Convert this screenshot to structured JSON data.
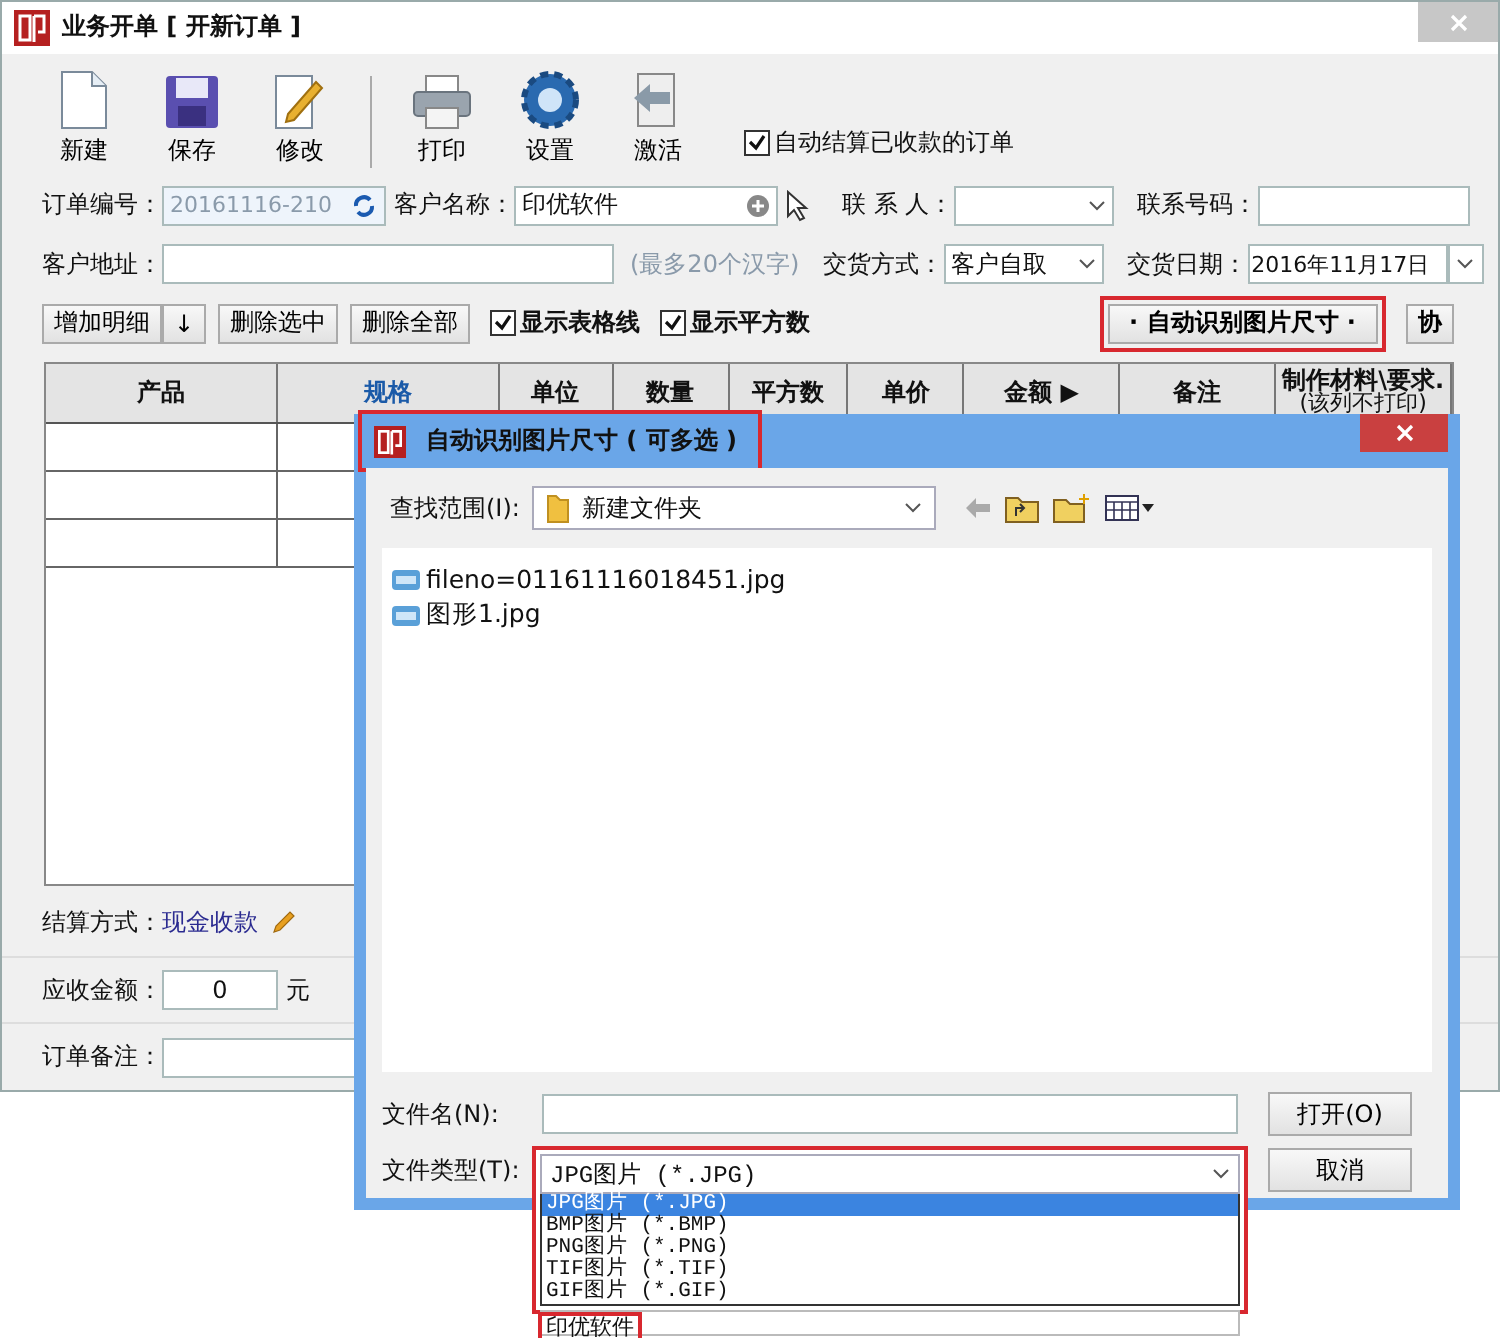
{
  "window": {
    "title": "业务开单 [ 开新订单 ]"
  },
  "toolbar": {
    "buttons": [
      {
        "label": "新建",
        "kind": "new"
      },
      {
        "label": "保存",
        "kind": "save"
      },
      {
        "label": "修改",
        "kind": "edit"
      },
      {
        "label": "打印",
        "kind": "print"
      },
      {
        "label": "设置",
        "kind": "settings"
      },
      {
        "label": "激活",
        "kind": "activate"
      }
    ],
    "auto_settle": {
      "label": "自动结算已收款的订单",
      "checked": true
    }
  },
  "form": {
    "order_no": {
      "label": "订单编号：",
      "value": "20161116-210"
    },
    "customer_name": {
      "label": "客户名称：",
      "value": "印优软件"
    },
    "contact": {
      "label": "联 系 人："
    },
    "phone": {
      "label": "联系号码："
    },
    "address": {
      "label": "客户地址：",
      "hint": "(最多20个汉字)"
    },
    "delivery_method": {
      "label": "交货方式：",
      "value": "客户自取"
    },
    "delivery_date": {
      "label": "交货日期：",
      "value": "2016年11月17日"
    }
  },
  "actions": {
    "buttons": [
      {
        "label": "增加明细"
      },
      {
        "label": "↓"
      },
      {
        "label": "删除选中"
      },
      {
        "label": "删除全部"
      }
    ],
    "checkboxes": [
      {
        "label": "显示表格线",
        "checked": true
      },
      {
        "label": "显示平方数",
        "checked": true
      }
    ],
    "auto_size": {
      "label": "· 自动识别图片尺寸 ·",
      "highlighted": true
    },
    "extra": {
      "label": "协"
    }
  },
  "table": {
    "columns": [
      {
        "label": "产品",
        "active": false
      },
      {
        "label": "规格",
        "active": true
      },
      {
        "label": "单位",
        "active": false
      },
      {
        "label": "数量",
        "active": false
      },
      {
        "label": "平方数",
        "active": false
      },
      {
        "label": "单价",
        "active": false
      },
      {
        "label": "金额 ▶",
        "active": false
      },
      {
        "label": "备注",
        "active": false
      },
      {
        "label": "制作材料\\要求.",
        "sublabel": "(该列不打印)",
        "active": false
      }
    ]
  },
  "footer": {
    "settlement": {
      "label": "结算方式：",
      "value": "现金收款"
    },
    "receivable": {
      "label": "应收金额：",
      "value": "0",
      "unit": "元"
    },
    "note": {
      "label": "订单备注："
    }
  },
  "dialog": {
    "title": "自动识别图片尺寸 ( 可多选 )",
    "highlighted": true,
    "look_in": {
      "label": "查找范围(I):",
      "value": "新建文件夹"
    },
    "files": [
      {
        "name": "fileno=01161116018451.jpg"
      },
      {
        "name": "图形1.jpg"
      }
    ],
    "file_name": {
      "label": "文件名(N):"
    },
    "file_type": {
      "label": "文件类型(T):",
      "value": "JPG图片 (*.JPG)",
      "highlighted": true,
      "options": [
        {
          "label": "JPG图片 (*.JPG)",
          "selected": true
        },
        {
          "label": "BMP图片 (*.BMP)",
          "selected": false
        },
        {
          "label": "PNG图片 (*.PNG)",
          "selected": false
        },
        {
          "label": "TIF图片 (*.TIF)",
          "selected": false
        },
        {
          "label": "GIF图片 (*.GIF)",
          "selected": false
        }
      ],
      "extra_item": {
        "label": "印优软件",
        "highlighted": true
      }
    },
    "buttons": [
      {
        "label": "打开(O)"
      },
      {
        "label": "取消"
      }
    ]
  }
}
